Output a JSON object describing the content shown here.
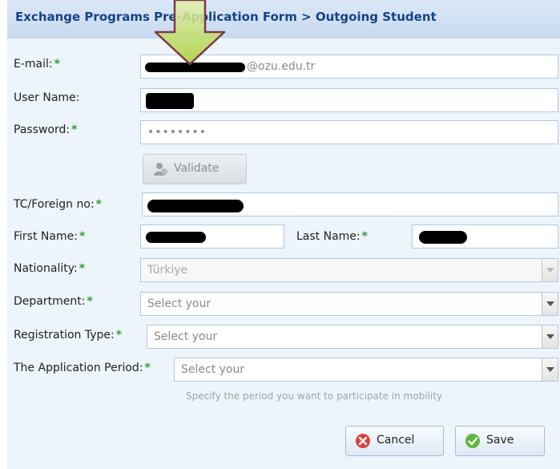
{
  "header": {
    "title": "Exchange Programs Pre-Application Form > Outgoing Student"
  },
  "labels": {
    "email": "E-mail:",
    "username": "User Name:",
    "password": "Password:",
    "tc": "TC/Foreign no:",
    "firstname": "First Name:",
    "lastname": "Last Name:",
    "nationality": "Nationality:",
    "department": "Department:",
    "regtype": "Registration Type:",
    "period": "The Application Period:",
    "required_marker": "*"
  },
  "fields": {
    "email_domain": "@ozu.edu.tr",
    "password_mask": "••••••••",
    "nationality_value": "Türkiye",
    "department_placeholder": "Select your",
    "regtype_placeholder": "Select your",
    "period_placeholder": "Select your"
  },
  "buttons": {
    "validate": "Validate",
    "cancel": "Cancel",
    "save": "Save"
  },
  "hint": "Specify the period you want to participate in mobility",
  "colors": {
    "header_bg": "#c8daf0",
    "header_text": "#15428b",
    "required": "#2e9e3b",
    "arrow_fill": "#c8e06a",
    "arrow_stroke": "#7b3a4a",
    "cancel_icon": "#d9433a",
    "save_icon": "#5cb83a"
  },
  "icons": {
    "validate": "user-check-icon",
    "cancel": "cancel-x-icon",
    "save": "checkmark-icon",
    "annotation": "down-arrow-icon"
  }
}
